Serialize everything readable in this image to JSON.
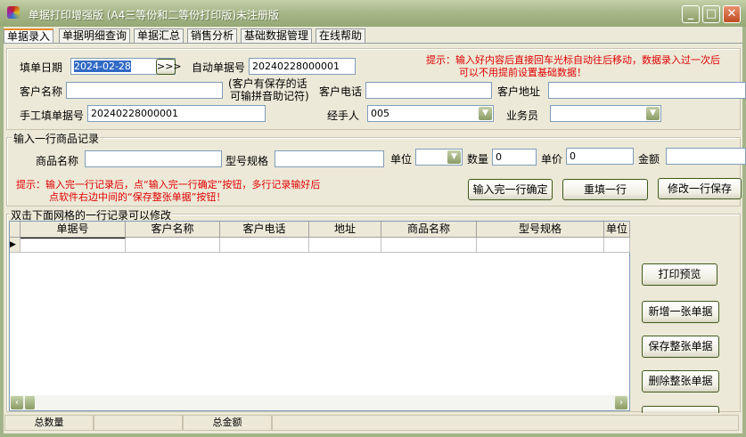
{
  "window": {
    "title": "单据打印增强版 (A4三等份和二等份打印版)未注册版",
    "min": "_",
    "max": "□",
    "close": "✕"
  },
  "tabs": [
    "单据录入",
    "单据明细查询",
    "单据汇总",
    "销售分析",
    "基础数据管理",
    "在线帮助"
  ],
  "header": {
    "date_label": "填单日期",
    "date_value": "2024-02-28",
    "date_btn": ">>>",
    "auto_no_label": "自动单据号",
    "auto_no_value": "20240228000001",
    "hint1": "提示：输入好内容后直接回车光标自动往后移动，数据录入过一次后",
    "hint2": "可以不用提前设置基础数据！",
    "customer_label": "客户名称",
    "customer_value": "",
    "customer_note1": "(客户有保存的话",
    "customer_note2": "可输拼音助记符)",
    "phone_label": "客户电话",
    "phone_value": "",
    "address_label": "客户地址",
    "address_value": "",
    "manual_no_label": "手工填单据号",
    "manual_no_value": "20240228000001",
    "handler_label": "经手人",
    "handler_value": "005",
    "salesman_label": "业务员",
    "salesman_value": ""
  },
  "item": {
    "group_title": "输入一行商品记录",
    "name_label": "商品名称",
    "name_value": "",
    "spec_label": "型号规格",
    "spec_value": "",
    "unit_label": "单位",
    "unit_value": "",
    "qty_label": "数量",
    "qty_value": "0",
    "price_label": "单价",
    "price_value": "0",
    "amount_label": "金额",
    "amount_value": "",
    "hint1": "提示：输入完一行记录后，点“输入完一行确定”按钮，多行记录输好后",
    "hint2": "点软件右边中间的“保存整张单据”按钮！",
    "confirm_btn": "输入完一行确定",
    "reset_btn": "重填一行",
    "modify_btn": "修改一行保存"
  },
  "grid": {
    "group_title": "双击下面网格的一行记录可以修改",
    "columns": [
      "单据号",
      "客户名称",
      "客户电话",
      "地址",
      "商品名称",
      "型号规格",
      "单位"
    ]
  },
  "side_buttons": [
    "打印预览",
    "新增一张单据",
    "保存整张单据",
    "删除整张单据"
  ],
  "status": {
    "total_qty_label": "总数量",
    "total_qty": "",
    "total_amount_label": "总金额",
    "total_amount": ""
  }
}
